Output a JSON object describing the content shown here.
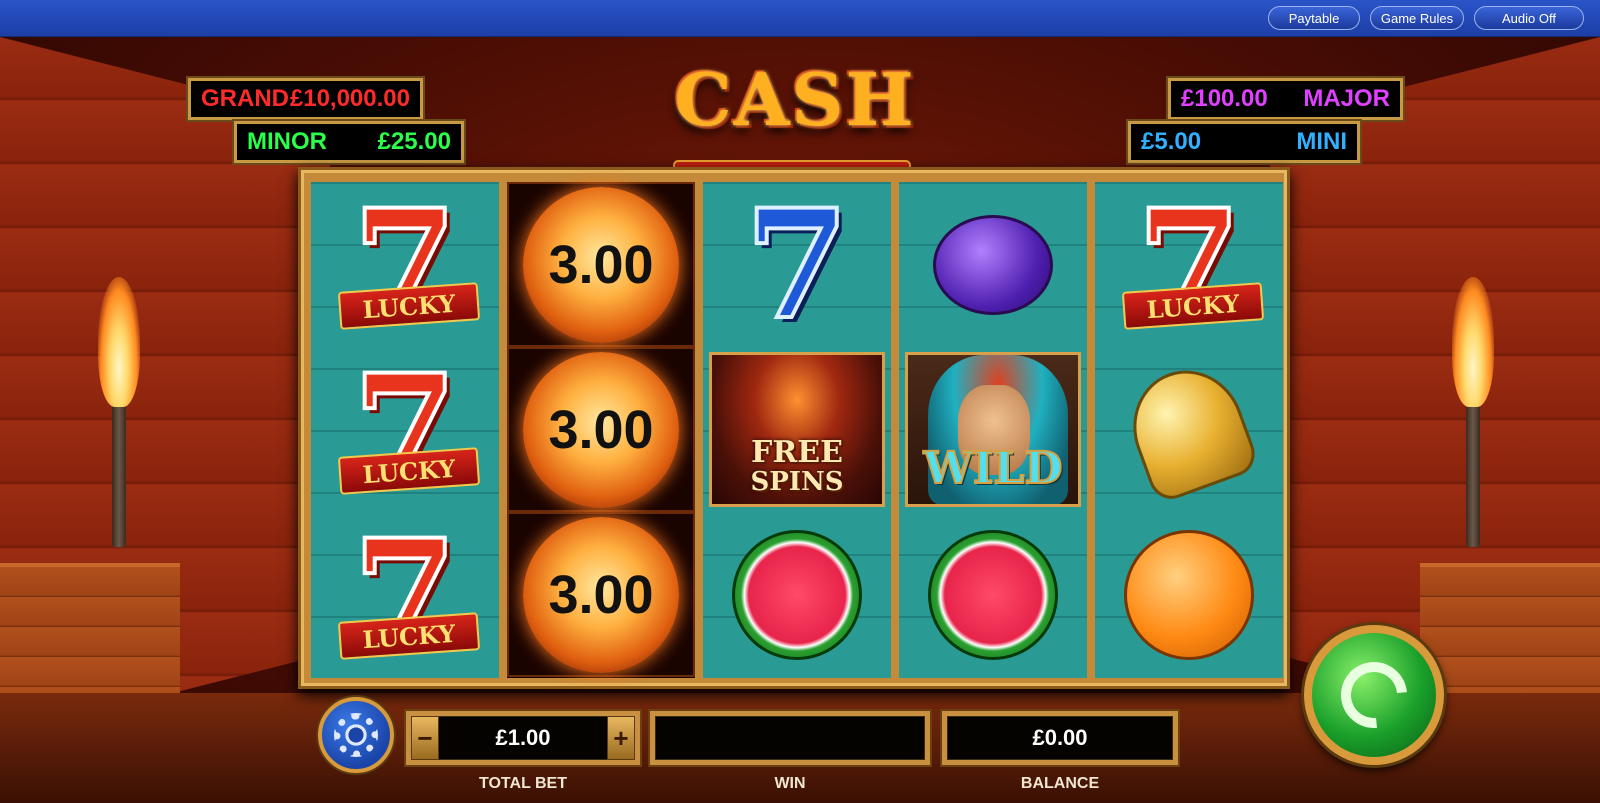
{
  "topbar": {
    "paytable_label": "Paytable",
    "rules_label": "Game Rules",
    "audio_label": "Audio Off"
  },
  "game": {
    "title": "CASH ERUPTION"
  },
  "jackpots": {
    "grand": {
      "name": "GRAND",
      "amount": "£10,000.00",
      "color": "#ff2a2a"
    },
    "minor": {
      "name": "MINOR",
      "amount": "£25.00",
      "color": "#2aff4a"
    },
    "major": {
      "name": "MAJOR",
      "amount": "£100.00",
      "color": "#e040ff"
    },
    "mini": {
      "name": "MINI",
      "amount": "£5.00",
      "color": "#30b0ff"
    }
  },
  "reels": [
    {
      "symbols": [
        {
          "type": "lucky-seven",
          "label": "LUCKY"
        },
        {
          "type": "lucky-seven",
          "label": "LUCKY"
        },
        {
          "type": "lucky-seven",
          "label": "LUCKY"
        }
      ]
    },
    {
      "symbols": [
        {
          "type": "cash-fireball",
          "value": "3.00"
        },
        {
          "type": "cash-fireball",
          "value": "3.00"
        },
        {
          "type": "cash-fireball",
          "value": "3.00"
        }
      ]
    },
    {
      "symbols": [
        {
          "type": "blue-seven"
        },
        {
          "type": "free-spins",
          "line1": "FREE",
          "line2": "SPINS"
        },
        {
          "type": "watermelon"
        }
      ]
    },
    {
      "symbols": [
        {
          "type": "plum"
        },
        {
          "type": "wild",
          "label": "WILD"
        },
        {
          "type": "watermelon"
        }
      ]
    },
    {
      "symbols": [
        {
          "type": "lucky-seven",
          "label": "LUCKY"
        },
        {
          "type": "bell"
        },
        {
          "type": "orange"
        }
      ]
    }
  ],
  "controls": {
    "bet_value": "£1.00",
    "bet_minus": "−",
    "bet_plus": "+",
    "win_value": "",
    "balance_value": "£0.00",
    "total_bet_label": "TOTAL BET",
    "win_label": "WIN",
    "balance_label": "BALANCE",
    "settings_icon": "gear-icon",
    "spin_icon": "spin-arrow-icon"
  }
}
